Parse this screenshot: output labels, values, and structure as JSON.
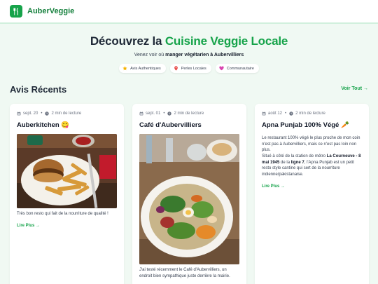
{
  "brand": {
    "name": "AuberVeggie"
  },
  "hero": {
    "title_prefix": "Découvrez la ",
    "title_accent": "Cuisine Veggie Locale",
    "subtitle_prefix": "Venez voir où ",
    "subtitle_bold": "manger végétarien à Aubervilliers",
    "badges": [
      {
        "label": "Avis Authentiques",
        "icon": "star-icon"
      },
      {
        "label": "Perles Locales",
        "icon": "location-pin-icon"
      },
      {
        "label": "Communautaire",
        "icon": "heart-icon"
      }
    ]
  },
  "section": {
    "title": "Avis Récents",
    "see_all": "Voir Tout →"
  },
  "cards": [
    {
      "date": "sept. 20",
      "read_time": "2 min de lecture",
      "title": "Auberkitchen 😋",
      "excerpt": "Très bon resto qui fait de la nourriture de qualité !",
      "read_more": "Lire Plus →"
    },
    {
      "date": "sept. 01",
      "read_time": "2 min de lecture",
      "title": "Café d'Aubervilliers",
      "excerpt": "J'ai testé récemment le Café d'Aubervilliers, un endroit bien sympathique juste derrière la mairie."
    },
    {
      "date": "août 12",
      "read_time": "2 min de lecture",
      "title": "Apna Punjab 100% Végé 🥕",
      "excerpt_1": "Le restaurant 100% végé le plus proche de mon coin n'est pas à Aubervilliers, mais ce n'est pas loin non plus.",
      "excerpt_2a": "Situé à côté de la station de métro ",
      "excerpt_2b": "La Courneuve - 8 mai 1945",
      "excerpt_2c": " de la ",
      "excerpt_2d": "ligne 7",
      "excerpt_2e": ", l'Apna Punjab est un petit resto style cantine qui sert de la nourriture indienne/pakistanaise.",
      "read_more": "Lire Plus →"
    }
  ],
  "colors": {
    "accent": "#16a34a",
    "background": "#f0f9f3"
  }
}
